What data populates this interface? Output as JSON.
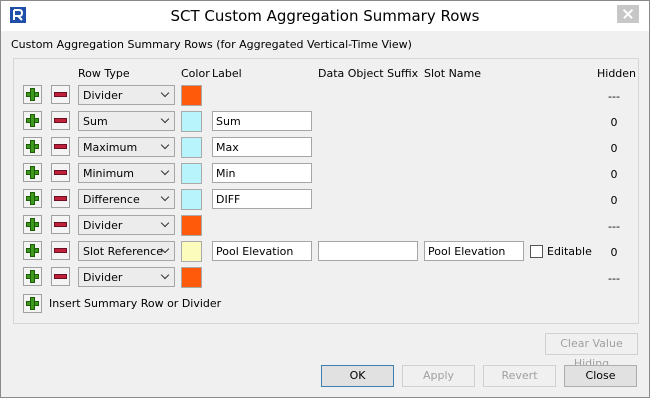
{
  "window": {
    "title": "SCT Custom Aggregation Summary Rows",
    "subtitle": "Custom Aggregation Summary Rows (for Aggregated Vertical-Time View)"
  },
  "headers": {
    "row_type": "Row Type",
    "color": "Color",
    "label": "Label",
    "suffix": "Data Object Suffix",
    "slot_name": "Slot Name",
    "hidden": "Hidden"
  },
  "rows": [
    {
      "type": "Divider",
      "color": "#ff5a0a",
      "label": "",
      "hidden": "---"
    },
    {
      "type": "Sum",
      "color": "#b8f4fc",
      "label": "Sum",
      "hidden": "0"
    },
    {
      "type": "Maximum",
      "color": "#b8f4fc",
      "label": "Max",
      "hidden": "0"
    },
    {
      "type": "Minimum",
      "color": "#b8f4fc",
      "label": "Min",
      "hidden": "0"
    },
    {
      "type": "Difference",
      "color": "#b8f4fc",
      "label": "DIFF",
      "hidden": "0"
    },
    {
      "type": "Divider",
      "color": "#ff5a0a",
      "label": "",
      "hidden": "---"
    },
    {
      "type": "Slot Reference",
      "color": "#fcfcbc",
      "label": "Pool Elevation",
      "suffix": "",
      "slot_name": "Pool Elevation",
      "editable_label": "Editable",
      "editable": false,
      "hidden": "0"
    },
    {
      "type": "Divider",
      "color": "#ff5a0a",
      "label": "",
      "hidden": "---"
    }
  ],
  "insert_label": "Insert Summary Row or Divider",
  "buttons": {
    "clear_hiding": "Clear Value Hiding",
    "ok": "OK",
    "apply": "Apply",
    "revert": "Revert",
    "close": "Close"
  }
}
